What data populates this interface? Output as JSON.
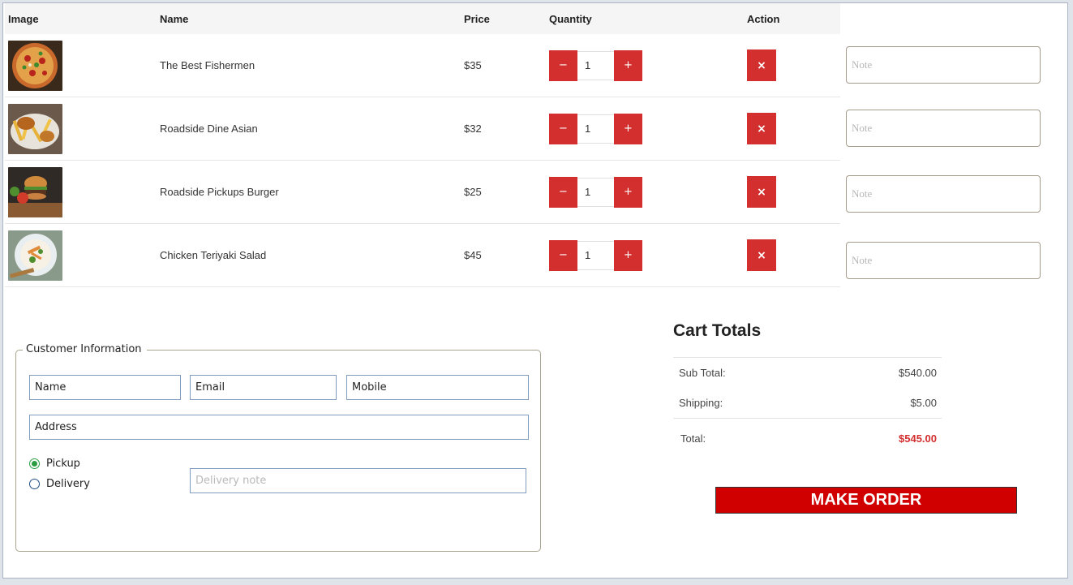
{
  "table": {
    "headers": {
      "image": "Image",
      "name": "Name",
      "price": "Price",
      "quantity": "Quantity",
      "action": "Action"
    },
    "rows": [
      {
        "name": "The Best Fishermen",
        "price": "$35",
        "qty": "1",
        "image_icon": "pizza-photo"
      },
      {
        "name": "Roadside Dine Asian",
        "price": "$32",
        "qty": "1",
        "image_icon": "fries-photo"
      },
      {
        "name": "Roadside Pickups Burger",
        "price": "$25",
        "qty": "1",
        "image_icon": "burger-photo"
      },
      {
        "name": "Chicken Teriyaki Salad",
        "price": "$45",
        "qty": "1",
        "image_icon": "salad-photo"
      }
    ],
    "minus_label": "−",
    "plus_label": "+",
    "remove_label": "×",
    "note_placeholder": "Note"
  },
  "customer": {
    "legend": "Customer Information",
    "name_placeholder": "Name",
    "email_placeholder": "Email",
    "mobile_placeholder": "Mobile",
    "address_placeholder": "Address",
    "pickup_label": "Pickup",
    "delivery_label": "Delivery",
    "selected": "Pickup",
    "delivery_note_placeholder": "Delivery note"
  },
  "totals": {
    "title": "Cart Totals",
    "subtotal_label": "Sub Total:",
    "subtotal_value": "$540.00",
    "shipping_label": "Shipping:",
    "shipping_value": "$5.00",
    "total_label": "Total:",
    "total_value": "$545.00"
  },
  "order_button": "MAKE ORDER",
  "colors": {
    "accent": "#d32f2f",
    "order_button": "#d10000",
    "selected_radio": "#2a9d41"
  }
}
